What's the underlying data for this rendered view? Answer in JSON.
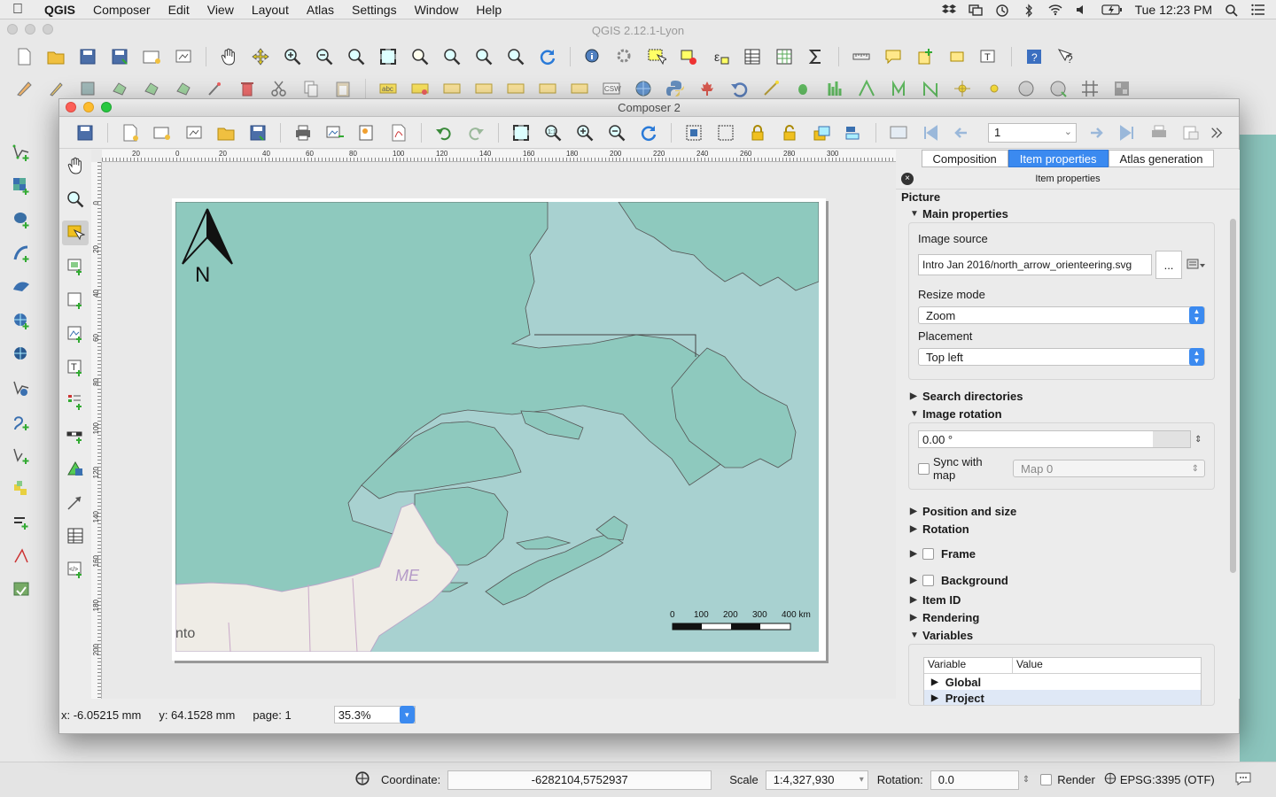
{
  "menubar": {
    "app_name": "QGIS",
    "items": [
      "Composer",
      "Edit",
      "View",
      "Layout",
      "Atlas",
      "Settings",
      "Window",
      "Help"
    ],
    "clock": "Tue 12:23 PM"
  },
  "main_window": {
    "title": "QGIS 2.12.1-Lyon"
  },
  "composer": {
    "title": "Composer 2",
    "page_number": "1",
    "tabs": [
      "Composition",
      "Item properties",
      "Atlas generation"
    ],
    "active_tab": "Item properties",
    "panel_title": "Item properties",
    "item_type": "Picture",
    "main_properties": {
      "label": "Main properties",
      "image_source_label": "Image source",
      "image_source_value": "Intro Jan 2016/north_arrow_orienteering.svg",
      "browse_label": "...",
      "resize_mode_label": "Resize mode",
      "resize_mode_value": "Zoom",
      "placement_label": "Placement",
      "placement_value": "Top left"
    },
    "sections": {
      "search_directories": "Search directories",
      "image_rotation": "Image rotation",
      "rotation_value": "0.00 °",
      "sync_with_map": "Sync with map",
      "sync_map_value": "Map 0",
      "position_and_size": "Position and size",
      "rotation": "Rotation",
      "frame": "Frame",
      "background": "Background",
      "item_id": "Item ID",
      "rendering": "Rendering",
      "variables": "Variables"
    },
    "variables_table": {
      "headers": [
        "Variable",
        "Value"
      ],
      "rows": [
        "Global",
        "Project"
      ]
    },
    "map": {
      "north_label": "N",
      "state_label": "ME",
      "city_label_partial": "nto",
      "scalebar_ticks": [
        "0",
        "100",
        "200",
        "300",
        "400 km"
      ]
    },
    "ruler_top": [
      "20",
      "0",
      "20",
      "40",
      "60",
      "80",
      "100",
      "120",
      "140",
      "160",
      "180",
      "200",
      "220",
      "240",
      "260",
      "280",
      "300"
    ],
    "ruler_left": [
      "0",
      "20",
      "40",
      "60",
      "80",
      "100",
      "120",
      "140",
      "160",
      "180",
      "200"
    ],
    "status": {
      "x": "x: -6.05215 mm",
      "y": "y: 64.1528 mm",
      "page": "page: 1",
      "zoom": "35.3%"
    }
  },
  "main_status": {
    "coordinate_label": "Coordinate:",
    "coordinate_value": "-6282104,5752937",
    "scale_label": "Scale",
    "scale_value": "1:4,327,930",
    "rotation_label": "Rotation:",
    "rotation_value": "0.0",
    "render_label": "Render",
    "crs": "EPSG:3395 (OTF)"
  },
  "colors": {
    "land_canada": "#8ec9be",
    "water": "#a9d2d3",
    "land_usa": "#efece6",
    "accent_blue": "#3b8af0"
  }
}
